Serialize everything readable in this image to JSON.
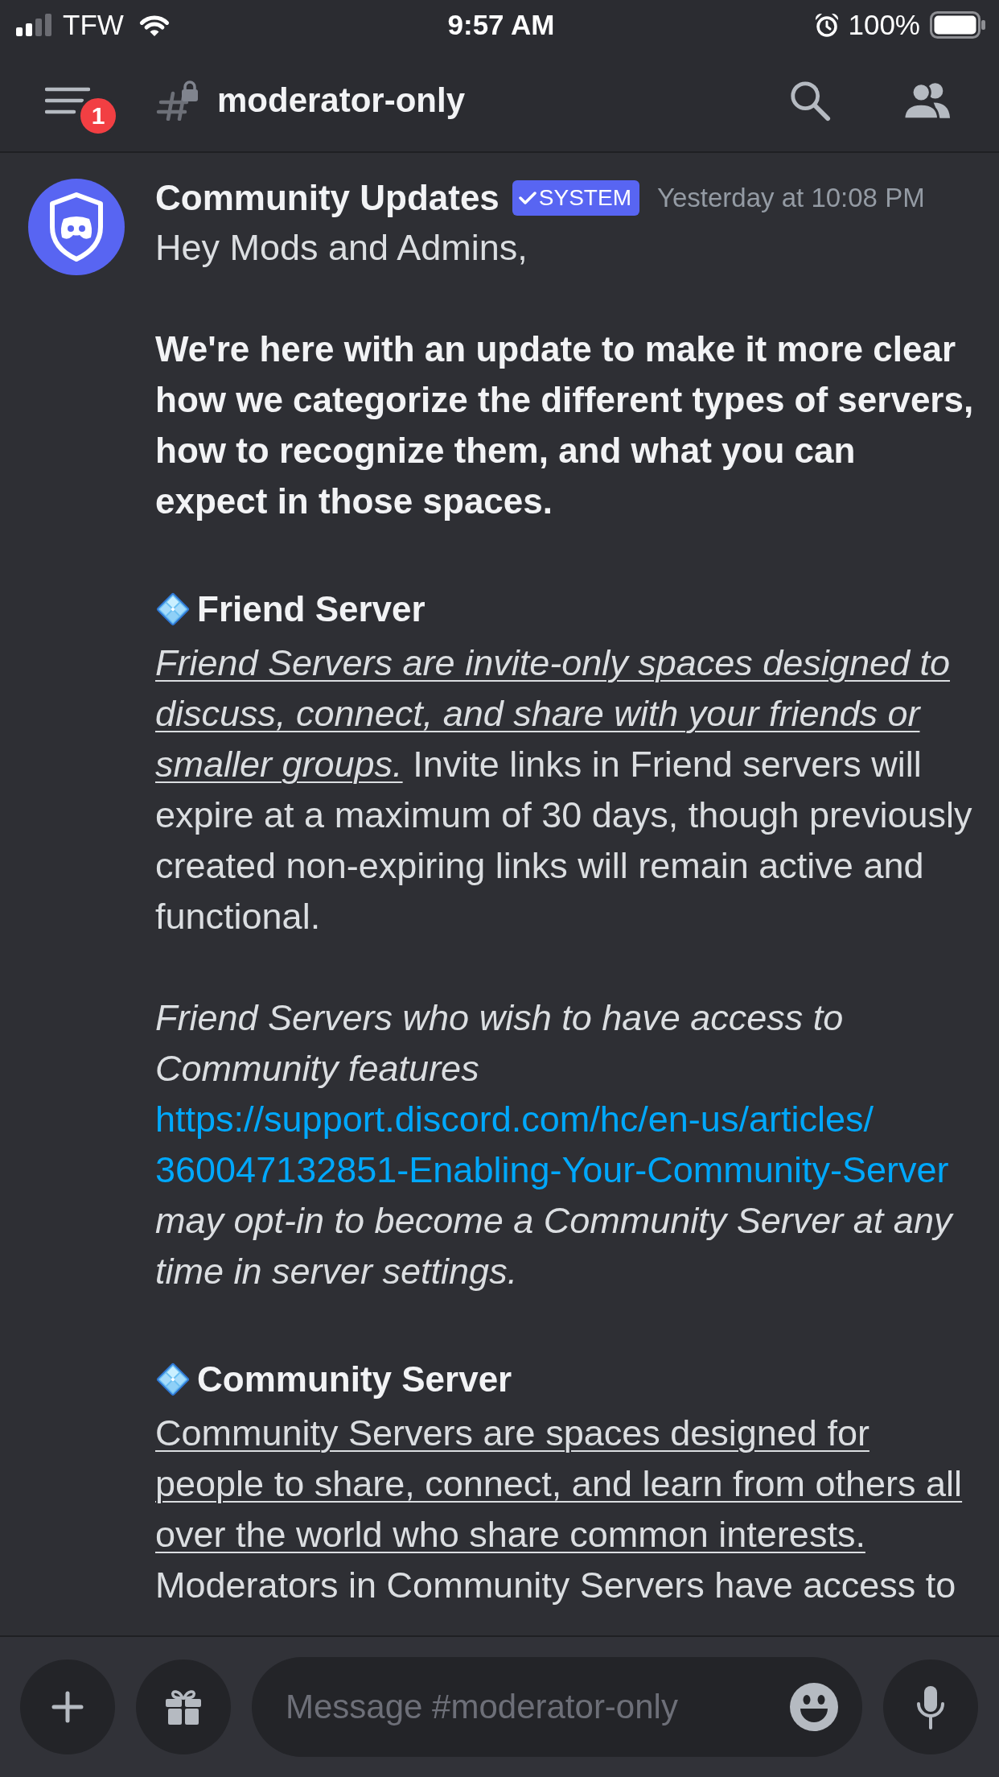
{
  "status_bar": {
    "carrier": "TFW",
    "time": "9:57 AM",
    "battery": "100%"
  },
  "header": {
    "unread_count": "1",
    "channel": "moderator-only"
  },
  "message": {
    "author": "Community Updates",
    "tag": "SYSTEM",
    "timestamp": "Yesterday at 10:08 PM",
    "blocks": [
      {
        "kind": "text",
        "text": "Hey Mods and Admins,"
      },
      {
        "kind": "lead",
        "text": "We're here with an update to make it more clear how we categorize the different types of servers, how to recognize them, and what you can expect in those spaces."
      },
      {
        "kind": "heading",
        "text": "Friend Server"
      },
      {
        "kind": "definition",
        "term": "*Friend Servers are invite-only spaces designed to discuss, connect, and share with your friends or smaller groups.*",
        "text": "Invite links in Friend servers will expire at a maximum of 30 days, though previously created non-expiring links will remain active and functional."
      },
      {
        "kind": "linked",
        "before": "Friend Servers who wish to have access to Community features",
        "link": "https://support.discord.com/hc/en-us/articles/360047132851-Enabling-Your-Community-Server",
        "after": "may opt-in to become a Community Server at any time in server settings."
      },
      {
        "kind": "heading",
        "text": "Community Server"
      },
      {
        "kind": "definition",
        "term": "Community Servers are spaces designed for people to share, connect, and learn from others all over the world who share common interests.",
        "text": "Moderators in Community Servers have access to"
      }
    ]
  },
  "composer": {
    "placeholder": "Message #moderator-only"
  }
}
